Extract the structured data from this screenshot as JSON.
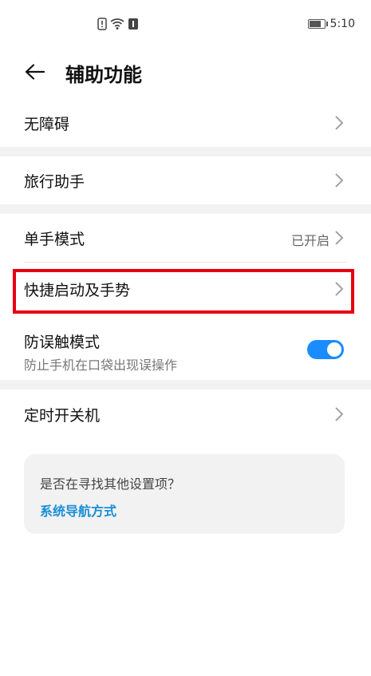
{
  "status_bar": {
    "time": "5:10",
    "icons": [
      "sim-alert-icon",
      "wifi-icon",
      "notification-icon"
    ]
  },
  "header": {
    "title": "辅助功能",
    "back_icon": "back-arrow-icon"
  },
  "rows": [
    {
      "label": "无障碍"
    },
    {
      "label": "旅行助手"
    },
    {
      "label": "单手模式",
      "value": "已开启"
    },
    {
      "label": "快捷启动及手势"
    },
    {
      "label": "防误触模式",
      "sublabel": "防止手机在口袋出现误操作",
      "toggle_on": true
    },
    {
      "label": "定时开关机"
    }
  ],
  "suggestion": {
    "question": "是否在寻找其他设置项？",
    "link": "系统导航方式"
  },
  "colors": {
    "accent": "#1a8cff",
    "highlight": "#e60012",
    "link": "#1a8fd6"
  }
}
